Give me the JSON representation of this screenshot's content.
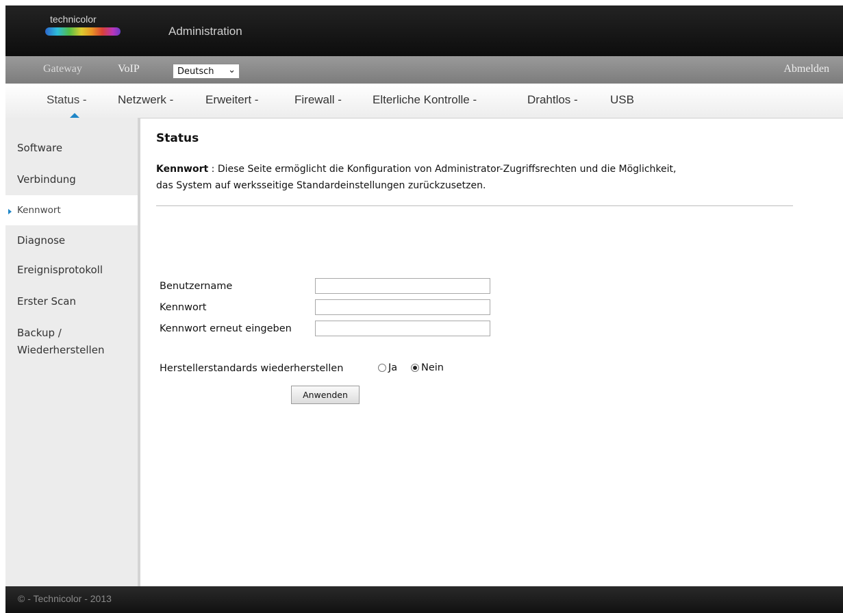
{
  "header": {
    "logo_text": "technicolor",
    "title": "Administration"
  },
  "top_nav": {
    "gateway": "Gateway",
    "voip": "VoIP",
    "language": "Deutsch",
    "logout": "Abmelden"
  },
  "tabs": [
    {
      "label": "Status -"
    },
    {
      "label": "Netzwerk -"
    },
    {
      "label": "Erweitert -"
    },
    {
      "label": "Firewall -"
    },
    {
      "label": "Elterliche Kontrolle -"
    },
    {
      "label": "Drahtlos -"
    },
    {
      "label": "USB"
    }
  ],
  "sidebar": {
    "items": [
      {
        "label": "Software"
      },
      {
        "label": "Verbindung"
      },
      {
        "label": "Kennwort"
      },
      {
        "label": "Diagnose"
      },
      {
        "label": "Ereignisprotokoll"
      },
      {
        "label": "Erster Scan"
      },
      {
        "label": "Backup /"
      },
      {
        "label": "Wiederherstellen"
      }
    ]
  },
  "main": {
    "title": "Status",
    "desc_key": "Kennwort",
    "desc_sep": ":",
    "desc_line1": "Diese Seite ermöglicht die Konfiguration von Administrator-Zugriffsrechten und die Möglichkeit,",
    "desc_line2": "das System auf werksseitige Standardeinstellungen zurückzusetzen.",
    "form": {
      "username_label": "Benutzername",
      "username_value": "",
      "password_label": "Kennwort",
      "password_value": "",
      "password_repeat_label": "Kennwort erneut eingeben",
      "password_repeat_value": "",
      "restore_label": "Herstellerstandards wiederherstellen",
      "yes_label": "Ja",
      "no_label": "Nein",
      "restore_selected": "Nein",
      "apply_label": "Anwenden"
    }
  },
  "footer": {
    "text": "© - Technicolor - 2013"
  },
  "colors": {
    "accent": "#1f86c7",
    "header_bg": "#1a1a1a",
    "nav_bg": "#8a8a8a",
    "sidebar_bg": "#ececec"
  }
}
